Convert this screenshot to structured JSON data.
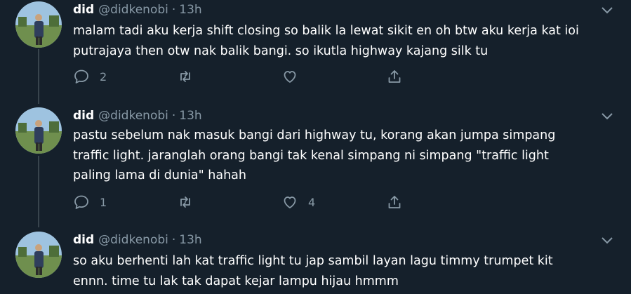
{
  "tweets": [
    {
      "name": "did",
      "handle": "@didkenobi",
      "separator": "·",
      "time": "13h",
      "lines": [
        "malam tadi aku kerja shift closing so balik la lewat sikit en oh btw aku kerja kat ioi",
        "putrajaya then otw nak balik bangi. so ikutla highway kajang silk tu"
      ],
      "replies": "2",
      "retweets": "",
      "likes": ""
    },
    {
      "name": "did",
      "handle": "@didkenobi",
      "separator": "·",
      "time": "13h",
      "lines": [
        "pastu sebelum nak masuk bangi dari highway tu, korang akan jumpa simpang",
        "traffic light. jaranglah orang bangi tak kenal simpang ni simpang \"traffic light",
        "paling lama di dunia\" hahah"
      ],
      "replies": "1",
      "retweets": "",
      "likes": "4"
    },
    {
      "name": "did",
      "handle": "@didkenobi",
      "separator": "·",
      "time": "13h",
      "lines": [
        "so aku berhenti lah kat traffic light tu jap sambil layan lagu timmy trumpet kit",
        "ennn. time tu lak tak dapat kejar lampu hijau hmmm"
      ],
      "replies": "",
      "retweets": "",
      "likes": ""
    }
  ],
  "icons": {
    "reply": "reply-icon",
    "retweet": "retweet-icon",
    "like": "heart-icon",
    "share": "share-icon",
    "more": "chevron-down-icon"
  },
  "colors": {
    "background": "#15202b",
    "secondary_text": "#8899a6",
    "thread_line": "#38444d"
  }
}
